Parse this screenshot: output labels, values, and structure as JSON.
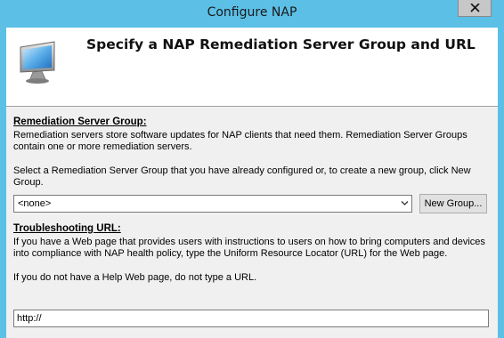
{
  "window": {
    "title": "Configure NAP"
  },
  "header": {
    "title": "Specify a NAP Remediation Server Group and URL",
    "icon": "computer-monitor-icon"
  },
  "remediation": {
    "label": "Remediation Server Group:",
    "description": "Remediation servers store software updates for NAP clients that need them. Remediation Server Groups contain one or more remediation servers.",
    "instruction": "Select a Remediation Server Group that you have already configured or, to create a new group, click New Group.",
    "selected": "<none>",
    "new_group_label": "New Group..."
  },
  "troubleshooting": {
    "label": "Troubleshooting URL:",
    "description": "If you have a Web page that provides users with instructions to users on how to bring computers and devices into compliance with NAP health policy, type the Uniform Resource Locator (URL) for the Web page.",
    "note": "If you do not have a Help Web page, do not type a URL.",
    "url_value": "http://"
  },
  "colors": {
    "titlebar": "#5bbfe6",
    "client_bg": "#f0f0f0",
    "header_bg": "#ffffff"
  }
}
